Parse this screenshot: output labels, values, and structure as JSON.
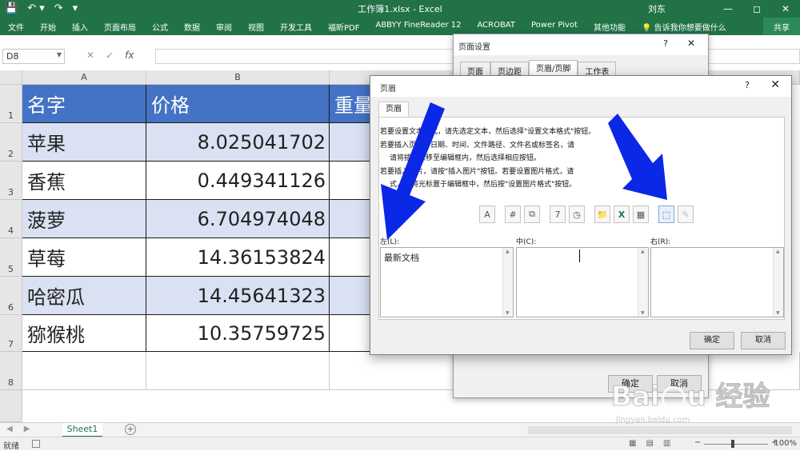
{
  "window": {
    "title": "工作簿1.xlsx  -  Excel",
    "user": "刘东",
    "min": "—",
    "restore": "◻",
    "close": "✕",
    "qat_save": "💾",
    "qat_undo": "↶ ▾",
    "qat_redo": "↷",
    "qat_more": "▾"
  },
  "ribbon": {
    "tabs": [
      "文件",
      "开始",
      "插入",
      "页面布局",
      "公式",
      "数据",
      "审阅",
      "视图",
      "开发工具",
      "福昕PDF",
      "ABBYY FineReader 12",
      "ACROBAT",
      "Power Pivot",
      "其他功能",
      "💡 告诉我你想要做什么"
    ],
    "share": "共享"
  },
  "formula_bar": {
    "name_box": "D8",
    "cancel": "✕",
    "enter": "✓",
    "fx": "fx",
    "value": ""
  },
  "sheet": {
    "columns": [
      "A",
      "B"
    ],
    "rows": [
      "1",
      "2",
      "3",
      "4",
      "5",
      "6",
      "7",
      "8"
    ],
    "header": [
      "名字",
      "价格",
      "重量"
    ],
    "data": [
      [
        "苹果",
        "8.025041702"
      ],
      [
        "香蕉",
        "0.449341126"
      ],
      [
        "菠萝",
        "6.704974048"
      ],
      [
        "草莓",
        "14.36153824"
      ],
      [
        "哈密瓜",
        "14.45641323"
      ],
      [
        "猕猴桃",
        "10.35759725"
      ]
    ]
  },
  "sheet_tabs": {
    "active": "Sheet1",
    "add": "+"
  },
  "status": {
    "ready": "就绪",
    "zoom": "100%",
    "zoom_out": "−",
    "zoom_in": "+"
  },
  "page_setup": {
    "title": "页面设置",
    "help": "?",
    "close": "✕",
    "tabs": [
      "页面",
      "页边距",
      "页眉/页脚",
      "工作表"
    ],
    "ok": "确定",
    "cancel": "取消"
  },
  "header_dialog": {
    "title": "页眉",
    "help": "?",
    "close": "✕",
    "tab": "页眉",
    "instructions": [
      "若要设置文本格式，请先选定文本，然后选择\"设置文本格式\"按钮。",
      "若要插入页码、日期、时间、文件路径、文件名或标签名，请",
      "请将插入点移至编辑框内，然后选择相应按钮。",
      "若要插入图片，请按\"插入图片\"按钮。若要设置图片格式，请",
      "式，请将光标置于编辑框中，然后按\"设置图片格式\"按钮。"
    ],
    "left_label": "左(L):",
    "center_label": "中(C):",
    "right_label": "右(R):",
    "left_value": "最新文档",
    "center_value": "",
    "right_value": "",
    "ok": "确定",
    "cancel": "取消",
    "tools": [
      "A",
      "#",
      "⧉",
      "7",
      "◷",
      "📁",
      "X",
      "▦",
      "⬚",
      "✎"
    ]
  },
  "watermark": {
    "brand": "Bai 经验",
    "url": "jingyan.baidu.com"
  },
  "colors": {
    "excel_green": "#217346",
    "header_fill": "#4472c4",
    "band_fill": "#d9e1f2",
    "arrow_blue": "#0a28e6"
  }
}
